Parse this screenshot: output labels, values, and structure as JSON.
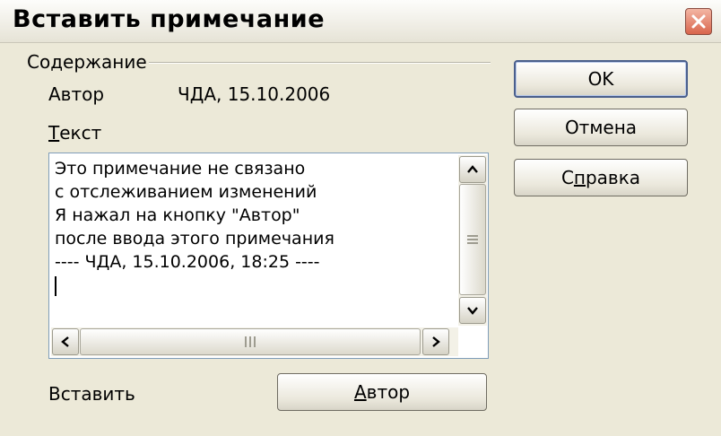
{
  "dialog": {
    "title": "Вставить примечание"
  },
  "content_group": {
    "label": "Содержание",
    "author_label": "Автор",
    "author_value": "ЧДА, 15.10.2006",
    "text_label_underlined": "Т",
    "text_label_rest": "екст",
    "text_lines": [
      "Это примечание не связано",
      "с отслеживанием изменений",
      "Я нажал на кнопку \"Автор\"",
      "после ввода этого примечания",
      "---- ЧДА, 15.10.2006, 18:25 ----"
    ]
  },
  "insert": {
    "label": "Вставить",
    "author_button_underlined": "А",
    "author_button_rest": "втор"
  },
  "buttons": {
    "ok": "OK",
    "cancel": "Отмена",
    "help_pre": "С",
    "help_underlined": "п",
    "help_post": "равка"
  },
  "icons": {
    "close": "close-icon",
    "scroll_up": "chevron-up-icon",
    "scroll_down": "chevron-down-icon",
    "scroll_left": "chevron-left-icon",
    "scroll_right": "chevron-right-icon"
  }
}
